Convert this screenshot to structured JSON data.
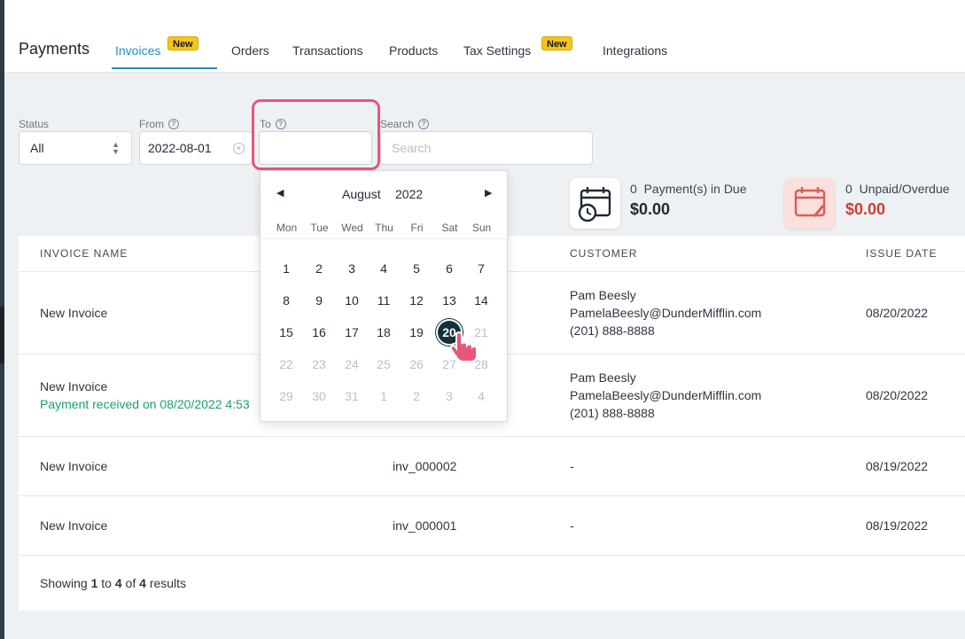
{
  "header": {
    "title": "Payments",
    "tabs": [
      {
        "label": "Invoices",
        "badge": "New",
        "active": true
      },
      {
        "label": "Orders"
      },
      {
        "label": "Transactions"
      },
      {
        "label": "Products"
      },
      {
        "label": "Tax Settings",
        "badge": "New"
      },
      {
        "label": "Integrations"
      }
    ]
  },
  "filters": {
    "status_label": "Status",
    "status_value": "All",
    "from_label": "From",
    "from_value": "2022-08-01",
    "to_label": "To",
    "to_value": "",
    "search_label": "Search",
    "search_placeholder": "Search"
  },
  "stats": {
    "due": {
      "count": "0",
      "label": "Payment(s) in Due",
      "amount": "$0.00",
      "icon": "calendar-clock-icon"
    },
    "unpaid": {
      "count": "0",
      "label": "Unpaid/Overdue",
      "amount": "$0.00",
      "icon": "calendar-edit-icon",
      "color": "#d33b35"
    }
  },
  "datepicker": {
    "month": "August",
    "year": "2022",
    "weekdays": [
      "Mon",
      "Tue",
      "Wed",
      "Thu",
      "Fri",
      "Sat",
      "Sun"
    ],
    "weeks": [
      [
        "1",
        "2",
        "3",
        "4",
        "5",
        "6",
        "7"
      ],
      [
        "8",
        "9",
        "10",
        "11",
        "12",
        "13",
        "14"
      ],
      [
        "15",
        "16",
        "17",
        "18",
        "19",
        "20",
        "21"
      ],
      [
        "22",
        "23",
        "24",
        "25",
        "26",
        "27",
        "28"
      ],
      [
        "29",
        "30",
        "31",
        "1",
        "2",
        "3",
        "4"
      ]
    ],
    "selected": "20",
    "accent": "#13323a"
  },
  "table": {
    "headers": [
      "INVOICE NAME",
      "CUSTOMER",
      "ISSUE DATE"
    ],
    "rows": [
      {
        "name": "New Invoice",
        "number": "",
        "customer_name": "Pam Beesly",
        "customer_email": "PamelaBeesly@DunderMifflin.com",
        "customer_phone": "(201) 888-8888",
        "issue_date": "08/20/2022"
      },
      {
        "name": "New Invoice",
        "status": "Payment received on 08/20/2022 4:53",
        "number": "",
        "customer_name": "Pam Beesly",
        "customer_email": "PamelaBeesly@DunderMifflin.com",
        "customer_phone": "(201) 888-8888",
        "issue_date": "08/20/2022"
      },
      {
        "name": "New Invoice",
        "number": "inv_000002",
        "customer": "-",
        "issue_date": "08/19/2022"
      },
      {
        "name": "New Invoice",
        "number": "inv_000001",
        "customer": "-",
        "issue_date": "08/19/2022"
      }
    ],
    "footer": {
      "prefix": "Showing",
      "from": "1",
      "to_word": "to",
      "to": "4",
      "of_word": "of",
      "total": "4",
      "suffix": "results"
    }
  },
  "colors": {
    "accent": "#1e90c6",
    "badge": "#f5c518",
    "highlight": "#e8567a",
    "success": "#18a06a"
  }
}
